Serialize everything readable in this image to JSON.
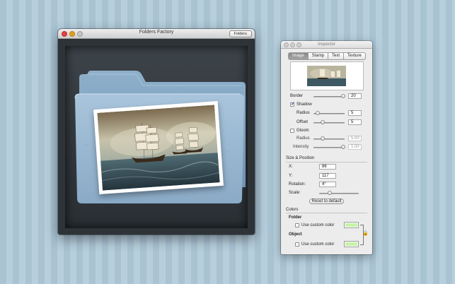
{
  "main_window": {
    "title": "Folders Factory",
    "folders_button": "Folders"
  },
  "inspector": {
    "title": "Inspector",
    "tabs": [
      {
        "label": "Image",
        "selected": true
      },
      {
        "label": "Stamp",
        "selected": false
      },
      {
        "label": "Text",
        "selected": false
      },
      {
        "label": "Texture",
        "selected": false
      }
    ],
    "border": {
      "label": "Border",
      "value": "20",
      "slider_fraction": 0.85
    },
    "shadow": {
      "label": "Shadow",
      "checked": true,
      "radius": {
        "label": "Radius",
        "value": "5",
        "slider_fraction": 0.1
      },
      "offset": {
        "label": "Offset",
        "value": "5",
        "slider_fraction": 0.25
      }
    },
    "gloom": {
      "label": "Gloom",
      "checked": false,
      "radius": {
        "label": "Radius",
        "value": "5.00",
        "slider_fraction": 0.25
      },
      "intensity": {
        "label": "Intensity",
        "value": "1.00",
        "slider_fraction": 0.85
      }
    },
    "size_position": {
      "heading": "Size & Position",
      "x": {
        "label": "X:",
        "value": "86"
      },
      "y": {
        "label": "Y:",
        "value": "117"
      },
      "rotation": {
        "label": "Rotation:",
        "value": "4°"
      },
      "scale": {
        "label": "Scale:",
        "slider_fraction": 0.3
      },
      "reset_button": "Reset to default"
    },
    "colors": {
      "heading": "Colors",
      "folder": {
        "label": "Folder",
        "checkbox_label": "Use custom color",
        "checked": false,
        "color": "#c8f2a8"
      },
      "object": {
        "label": "Object",
        "checkbox_label": "Use custom color",
        "checked": false,
        "color": "#c8f2a8"
      }
    }
  }
}
